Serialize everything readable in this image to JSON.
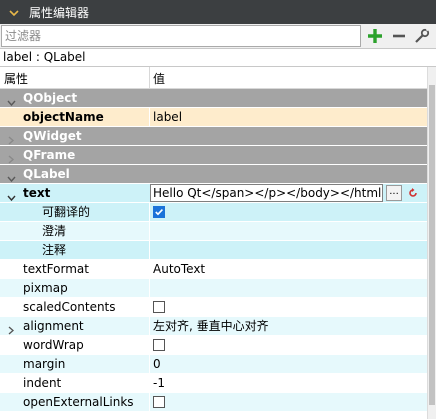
{
  "panel": {
    "title": "属性编辑器",
    "icons": {
      "collapse": "chevron-down-icon",
      "add": "plus-icon",
      "remove": "minus-icon",
      "config": "wrench-icon"
    }
  },
  "filter": {
    "placeholder": "过滤器",
    "value": ""
  },
  "class_line": "label : QLabel",
  "header": {
    "property": "属性",
    "value": "值"
  },
  "colors": {
    "title_bg": "#3c3f41",
    "group_bg": "#a4a4a4",
    "row_cyan": "#cdf2f8",
    "row_alt": "#e6f9fc",
    "row_highlight": "#feeccc",
    "accent_green": "#2ca12c",
    "checkbox_blue": "#1a73d9",
    "reset_red": "#d03030"
  },
  "rows": [
    {
      "kind": "group",
      "name": "QObject",
      "expanded": true
    },
    {
      "kind": "prop",
      "name": "objectName",
      "value": "label",
      "bold": true,
      "highlight": true
    },
    {
      "kind": "group",
      "name": "QWidget",
      "expanded": false
    },
    {
      "kind": "group",
      "name": "QFrame",
      "expanded": false
    },
    {
      "kind": "group",
      "name": "QLabel",
      "expanded": true
    },
    {
      "kind": "prop",
      "name": "text",
      "value": "Hello Qt</span></p></body></html>",
      "bold": true,
      "expanded": true,
      "editor": "text"
    },
    {
      "kind": "sub",
      "name": "可翻译的",
      "checkbox": true,
      "checked": true
    },
    {
      "kind": "sub",
      "name": "澄清",
      "value": ""
    },
    {
      "kind": "sub",
      "name": "注释",
      "value": ""
    },
    {
      "kind": "prop",
      "name": "textFormat",
      "value": "AutoText"
    },
    {
      "kind": "prop",
      "name": "pixmap",
      "value": ""
    },
    {
      "kind": "prop",
      "name": "scaledContents",
      "checkbox": true,
      "checked": false
    },
    {
      "kind": "prop",
      "name": "alignment",
      "value": "左对齐, 垂直中心对齐",
      "expandable": true
    },
    {
      "kind": "prop",
      "name": "wordWrap",
      "checkbox": true,
      "checked": false
    },
    {
      "kind": "prop",
      "name": "margin",
      "value": "0"
    },
    {
      "kind": "prop",
      "name": "indent",
      "value": "-1"
    },
    {
      "kind": "prop",
      "name": "openExternalLinks",
      "checkbox": true,
      "checked": false
    }
  ],
  "text_editor": {
    "more_label": "..."
  }
}
